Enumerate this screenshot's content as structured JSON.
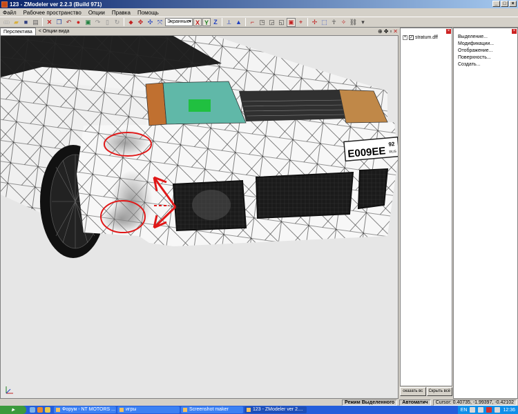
{
  "window": {
    "title": "123 - ZModeler ver 2.2.3 (Build 971)",
    "buttons": [
      "_",
      "□",
      "×"
    ]
  },
  "menu": [
    "Файл",
    "Рабочее пространство",
    "Опции",
    "Правка",
    "Помощь"
  ],
  "toolbar": {
    "combo_value": "Экранные",
    "axes": [
      "X",
      "Y",
      "Z"
    ]
  },
  "viewport": {
    "tab_label": "Перспектива",
    "options_label": "< Опции вида",
    "plate_text": "E009EE",
    "plate_region": "92",
    "plate_suffix": "RUS"
  },
  "scene_tree": {
    "expander": "+",
    "check": "✓",
    "item_label": "stratum.dff",
    "buttons": [
      "оказать вс",
      "Скрыть всё"
    ]
  },
  "right_panel": {
    "items": [
      "Выделение...",
      "Модификации...",
      "Отображение...",
      "Поверхность...",
      "Создать..."
    ]
  },
  "status": {
    "mode": "Режим Выделенного",
    "auto": "Автоматич",
    "cursor": "Cursor: 0.40735, -1.99397, -0.42102"
  },
  "taskbar": {
    "tasks": [
      "Форум - NT MOTORS ...",
      "игры",
      "Screenshot maker",
      "123 - ZModeler ver 2...."
    ],
    "tray_lang": "EN",
    "clock": "12:36"
  },
  "colors": {
    "title_start": "#0a246a",
    "title_end": "#a6caf0",
    "viewport_bg": "#e6e6e6",
    "annotation": "#e01818",
    "taskbar": "#245edb"
  }
}
